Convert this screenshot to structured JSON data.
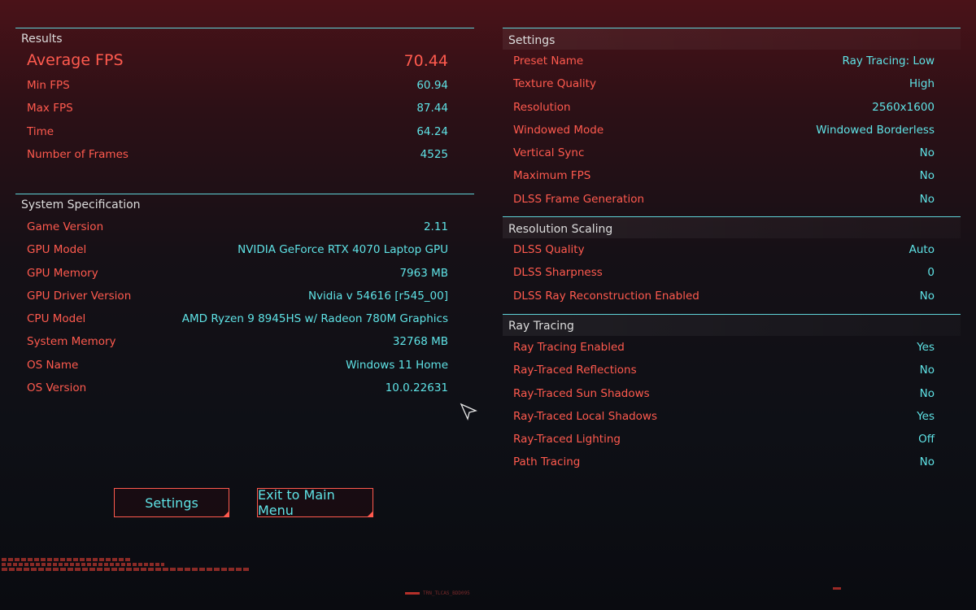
{
  "results": {
    "title": "Results",
    "rows": [
      {
        "label": "Average FPS",
        "value": "70.44"
      },
      {
        "label": "Min FPS",
        "value": "60.94"
      },
      {
        "label": "Max FPS",
        "value": "87.44"
      },
      {
        "label": "Time",
        "value": "64.24"
      },
      {
        "label": "Number of Frames",
        "value": "4525"
      }
    ]
  },
  "system": {
    "title": "System Specification",
    "rows": [
      {
        "label": "Game Version",
        "value": "2.11"
      },
      {
        "label": "GPU Model",
        "value": "NVIDIA GeForce RTX 4070 Laptop GPU"
      },
      {
        "label": "GPU Memory",
        "value": "7963 MB"
      },
      {
        "label": "GPU Driver Version",
        "value": "Nvidia v 54616 [r545_00]"
      },
      {
        "label": "CPU Model",
        "value": "AMD Ryzen 9 8945HS w/ Radeon 780M Graphics"
      },
      {
        "label": "System Memory",
        "value": "32768 MB"
      },
      {
        "label": "OS Name",
        "value": "Windows 11 Home"
      },
      {
        "label": "OS Version",
        "value": "10.0.22631"
      }
    ]
  },
  "settings": {
    "title": "Settings",
    "rows": [
      {
        "label": "Preset Name",
        "value": "Ray Tracing: Low"
      },
      {
        "label": "Texture Quality",
        "value": "High"
      },
      {
        "label": "Resolution",
        "value": "2560x1600"
      },
      {
        "label": "Windowed Mode",
        "value": "Windowed Borderless"
      },
      {
        "label": "Vertical Sync",
        "value": "No"
      },
      {
        "label": "Maximum FPS",
        "value": "No"
      },
      {
        "label": "DLSS Frame Generation",
        "value": "No"
      }
    ]
  },
  "scaling": {
    "title": "Resolution Scaling",
    "rows": [
      {
        "label": "DLSS Quality",
        "value": "Auto"
      },
      {
        "label": "DLSS Sharpness",
        "value": "0"
      },
      {
        "label": "DLSS Ray Reconstruction Enabled",
        "value": "No"
      }
    ]
  },
  "raytracing": {
    "title": "Ray Tracing",
    "rows": [
      {
        "label": "Ray Tracing Enabled",
        "value": "Yes"
      },
      {
        "label": "Ray-Traced Reflections",
        "value": "No"
      },
      {
        "label": "Ray-Traced Sun Shadows",
        "value": "No"
      },
      {
        "label": "Ray-Traced Local Shadows",
        "value": "Yes"
      },
      {
        "label": "Ray-Traced Lighting",
        "value": "Off"
      },
      {
        "label": "Path Tracing",
        "value": "No"
      }
    ]
  },
  "buttons": {
    "settings": "Settings",
    "exit": "Exit to Main Menu"
  },
  "footer": {
    "watermark": "TRN_TLCAS_BDD095"
  },
  "colors": {
    "label": "#ff5a4e",
    "value": "#5fe3e6",
    "divider": "#5fd3d8"
  },
  "icons": {
    "cursor": "arrow-cursor-icon"
  }
}
